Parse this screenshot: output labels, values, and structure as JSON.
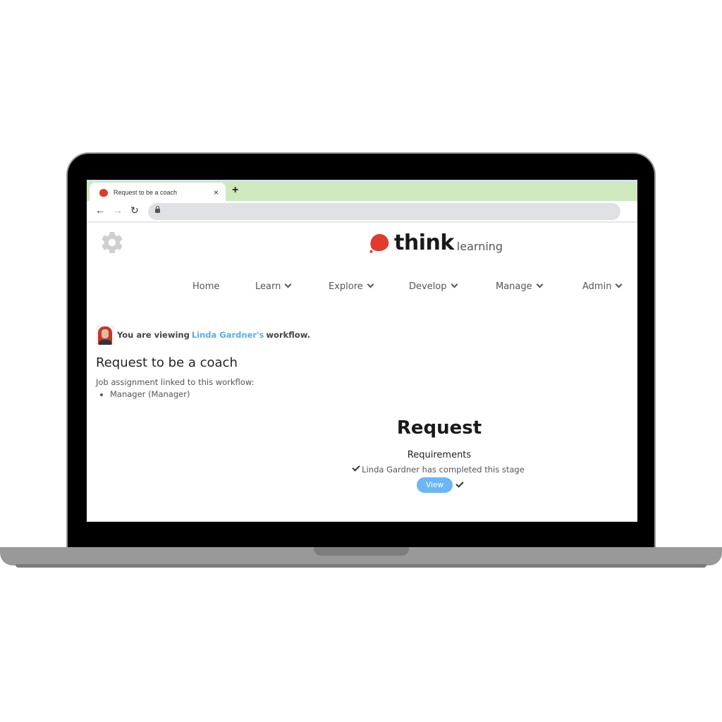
{
  "browser": {
    "tab_title": "Request to be a coach",
    "tab_close_label": "×",
    "new_tab_label": "+",
    "back_label": "←",
    "forward_label": "→",
    "reload_label": "↻",
    "address": ""
  },
  "brand": {
    "name": "think",
    "suffix": "learning",
    "accent_color": "#e03b2c"
  },
  "nav": {
    "items": [
      {
        "label": "Home",
        "has_dropdown": false
      },
      {
        "label": "Learn",
        "has_dropdown": true
      },
      {
        "label": "Explore",
        "has_dropdown": true
      },
      {
        "label": "Develop",
        "has_dropdown": true
      },
      {
        "label": "Manage",
        "has_dropdown": true
      },
      {
        "label": "Admin",
        "has_dropdown": true
      }
    ]
  },
  "viewing": {
    "prefix": "You are viewing",
    "user_link": "Linda Gardner's",
    "suffix": "workflow.",
    "link_color": "#5aaaf0"
  },
  "workflow": {
    "title": "Request to be a coach",
    "job_assignment_label": "Job assignment linked to this workflow:",
    "job_assignments": [
      "Manager (Manager)"
    ]
  },
  "stage": {
    "title": "Request",
    "requirements_label": "Requirements",
    "completed_text": "Linda Gardner has completed this stage",
    "view_button": "View",
    "view_button_color": "#6bb6f7"
  }
}
